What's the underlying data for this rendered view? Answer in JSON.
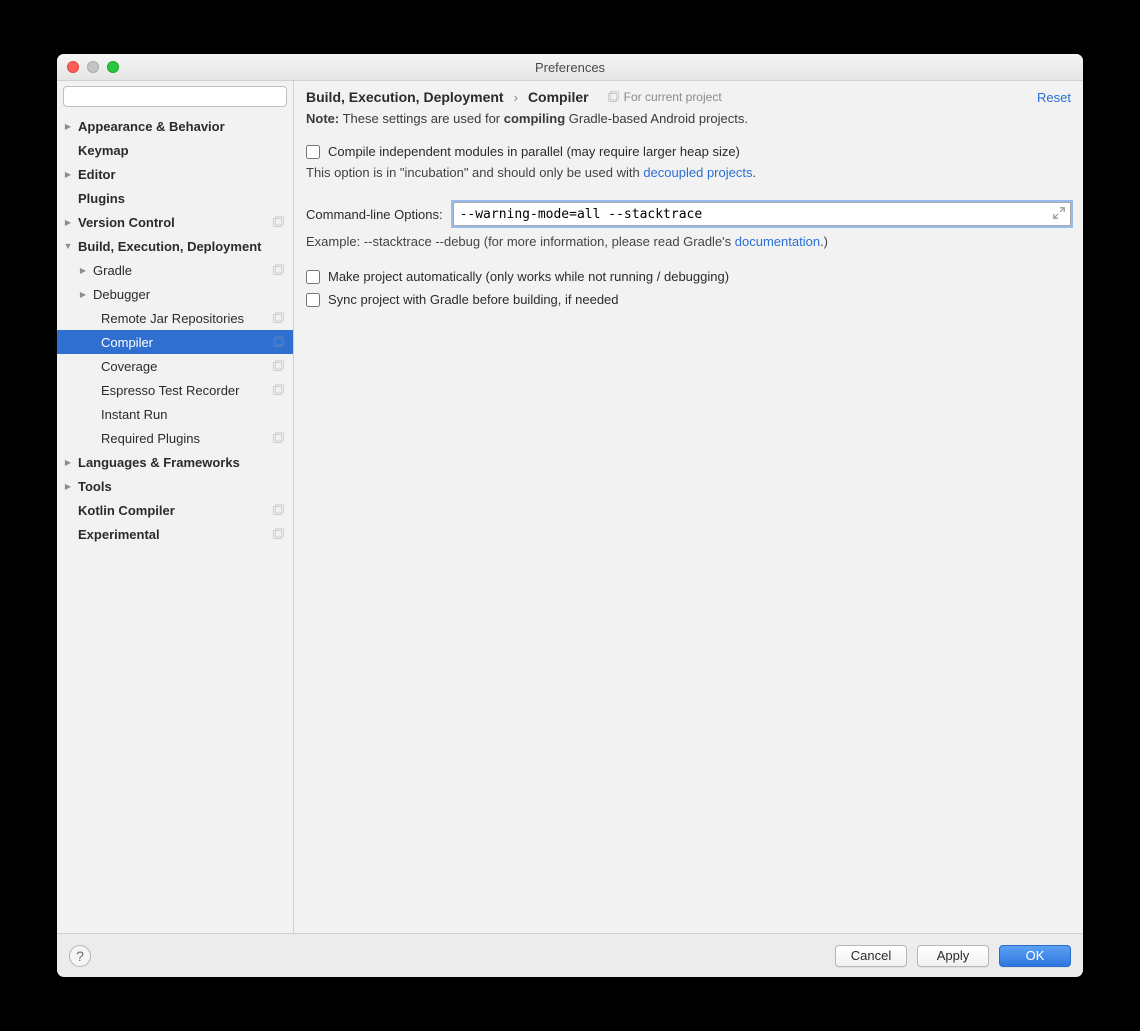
{
  "window": {
    "title": "Preferences"
  },
  "sidebar": {
    "search_placeholder": "",
    "items": [
      {
        "label": "Appearance & Behavior",
        "depth": 0,
        "arrow": "right",
        "proj": false
      },
      {
        "label": "Keymap",
        "depth": 0,
        "arrow": "none",
        "proj": false,
        "bold": true
      },
      {
        "label": "Editor",
        "depth": 0,
        "arrow": "right",
        "proj": false
      },
      {
        "label": "Plugins",
        "depth": 0,
        "arrow": "none",
        "proj": false,
        "bold": true
      },
      {
        "label": "Version Control",
        "depth": 0,
        "arrow": "right",
        "proj": true
      },
      {
        "label": "Build, Execution, Deployment",
        "depth": 0,
        "arrow": "down",
        "proj": false
      },
      {
        "label": "Gradle",
        "depth": 1,
        "arrow": "right",
        "proj": true
      },
      {
        "label": "Debugger",
        "depth": 1,
        "arrow": "right",
        "proj": false
      },
      {
        "label": "Remote Jar Repositories",
        "depth": 2,
        "arrow": "none",
        "proj": true
      },
      {
        "label": "Compiler",
        "depth": 2,
        "arrow": "none",
        "proj": true,
        "selected": true
      },
      {
        "label": "Coverage",
        "depth": 2,
        "arrow": "none",
        "proj": true
      },
      {
        "label": "Espresso Test Recorder",
        "depth": 2,
        "arrow": "none",
        "proj": true
      },
      {
        "label": "Instant Run",
        "depth": 2,
        "arrow": "none",
        "proj": false
      },
      {
        "label": "Required Plugins",
        "depth": 2,
        "arrow": "none",
        "proj": true
      },
      {
        "label": "Languages & Frameworks",
        "depth": 0,
        "arrow": "right",
        "proj": false
      },
      {
        "label": "Tools",
        "depth": 0,
        "arrow": "right",
        "proj": false
      },
      {
        "label": "Kotlin Compiler",
        "depth": 0,
        "arrow": "none",
        "proj": true,
        "bold": true
      },
      {
        "label": "Experimental",
        "depth": 0,
        "arrow": "none",
        "proj": true,
        "bold": true
      }
    ]
  },
  "header": {
    "crumb1": "Build, Execution, Deployment",
    "crumb2": "Compiler",
    "hint": "For current project",
    "reset": "Reset"
  },
  "noteParts": {
    "lead": "Note:",
    "mid": " These settings are used for ",
    "strong": "compiling",
    "tail": " Gradle-based Android projects."
  },
  "form": {
    "parallel_label": "Compile independent modules in parallel (may require larger heap size)",
    "parallel_sub_pre": "This option is in \"incubation\" and should only be used with ",
    "parallel_sub_link": "decoupled projects",
    "parallel_sub_post": ".",
    "cmd_label": "Command-line Options:",
    "cmd_value": "--warning-mode=all --stacktrace",
    "example_pre": "Example: --stacktrace --debug (for more information, please read Gradle's ",
    "example_link": "documentation",
    "example_post": ".)",
    "auto_label": "Make project automatically (only works while not running / debugging)",
    "sync_label": "Sync project with Gradle before building, if needed"
  },
  "footer": {
    "cancel": "Cancel",
    "apply": "Apply",
    "ok": "OK"
  }
}
